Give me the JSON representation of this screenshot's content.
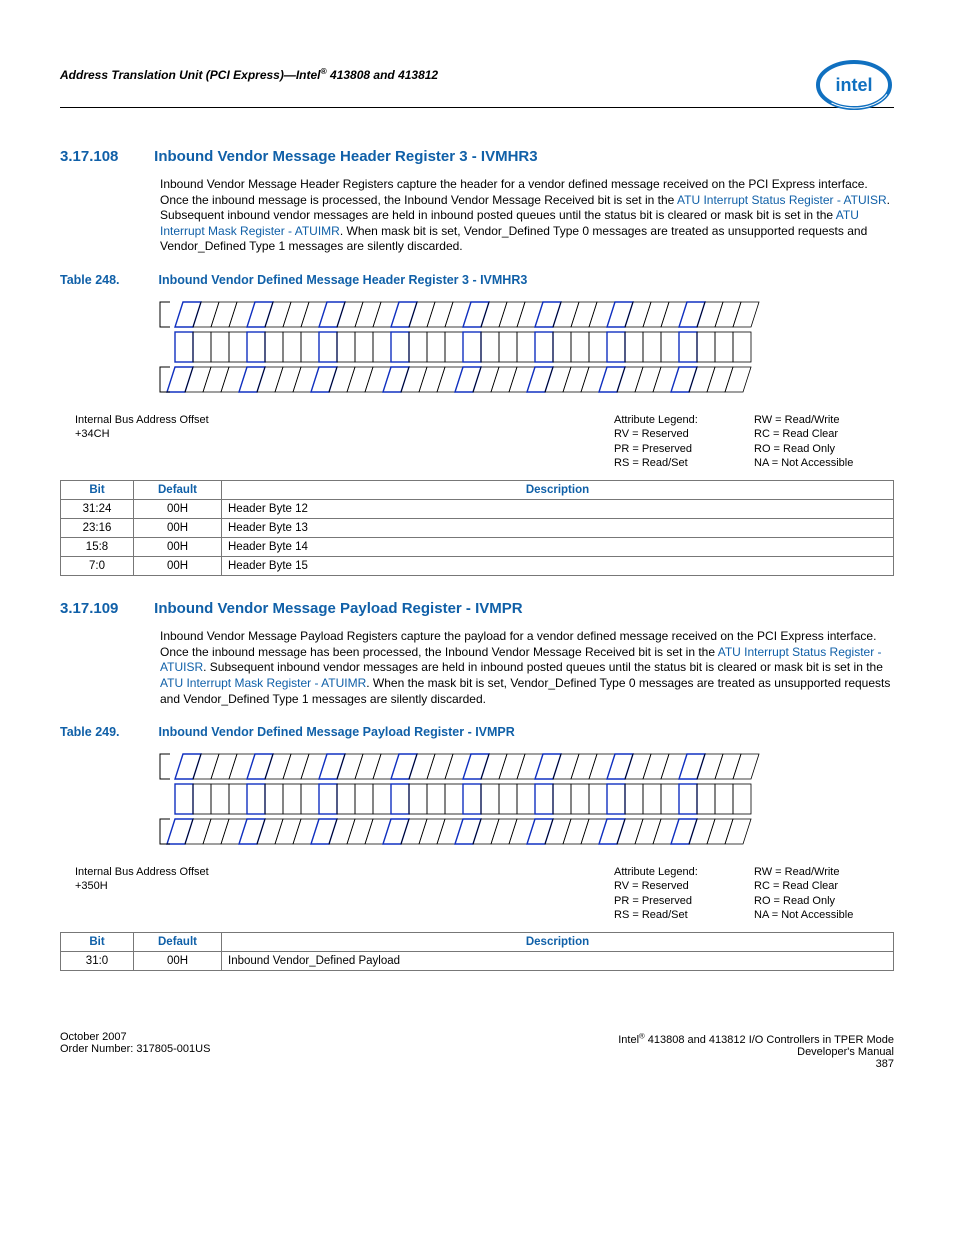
{
  "header": {
    "title_html": "Address Translation Unit (PCI Express)—Intel® 413808 and 413812"
  },
  "section1": {
    "number": "3.17.108",
    "title": "Inbound Vendor Message Header Register 3 - IVMHR3",
    "para_pre": "Inbound Vendor Message Header Registers capture the header for a vendor defined message received on the PCI Express interface. Once the inbound message is processed, the Inbound Vendor Message Received bit is set in the ",
    "link1": "ATU Interrupt Status Register - ATUISR",
    "para_mid": ". Subsequent inbound vendor messages are held in inbound posted queues until the status bit is cleared or mask bit is set in the ",
    "link2": "ATU Interrupt Mask Register - ATUIMR",
    "para_post": ". When mask bit is set, Vendor_Defined Type 0 messages are treated as unsupported requests and Vendor_Defined Type 1 messages are silently discarded.",
    "table_number": "Table 248.",
    "table_title": "Inbound Vendor Defined Message Header Register 3 - IVMHR3",
    "offset_label": "Internal Bus Address Offset",
    "offset_value": "+34CH",
    "table_headers": {
      "bit": "Bit",
      "default": "Default",
      "desc": "Description"
    },
    "rows": [
      {
        "bit": "31:24",
        "def": "00H",
        "desc": "Header Byte 12"
      },
      {
        "bit": "23:16",
        "def": "00H",
        "desc": "Header Byte 13"
      },
      {
        "bit": "15:8",
        "def": "00H",
        "desc": "Header Byte 14"
      },
      {
        "bit": "7:0",
        "def": "00H",
        "desc": "Header Byte 15"
      }
    ]
  },
  "section2": {
    "number": "3.17.109",
    "title": "Inbound Vendor Message Payload Register - IVMPR",
    "para_pre": "Inbound Vendor Message Payload Registers capture the payload for a vendor defined message received on the PCI Express interface. Once the inbound message has been processed, the Inbound Vendor Message Received bit is set in the ",
    "link1": "ATU Interrupt Status Register - ATUISR",
    "para_mid": ". Subsequent inbound vendor messages are held in inbound posted queues until the status bit is cleared or mask bit is set in the ",
    "link2": "ATU Interrupt Mask Register - ATUIMR",
    "para_post": ". When the mask bit is set, Vendor_Defined Type 0 messages are treated as unsupported requests and Vendor_Defined Type 1 messages are silently discarded.",
    "table_number": "Table 249.",
    "table_title": "Inbound Vendor Defined Message Payload Register - IVMPR",
    "offset_label": "Internal Bus Address Offset",
    "offset_value": "+350H",
    "table_headers": {
      "bit": "Bit",
      "default": "Default",
      "desc": "Description"
    },
    "rows": [
      {
        "bit": "31:0",
        "def": "00H",
        "desc": "Inbound Vendor_Defined Payload"
      }
    ]
  },
  "legend": {
    "attr_label": "Attribute Legend:",
    "left": [
      "RV = Reserved",
      "PR = Preserved",
      "RS = Read/Set"
    ],
    "right": [
      "RW = Read/Write",
      "RC = Read Clear",
      "RO = Read Only",
      "NA = Not Accessible"
    ]
  },
  "footer": {
    "left1": "October 2007",
    "left2": "Order Number: 317805-001US",
    "right1": "Intel® 413808 and 413812 I/O Controllers in TPER Mode",
    "right2": "Developer's Manual",
    "right3": "387"
  }
}
